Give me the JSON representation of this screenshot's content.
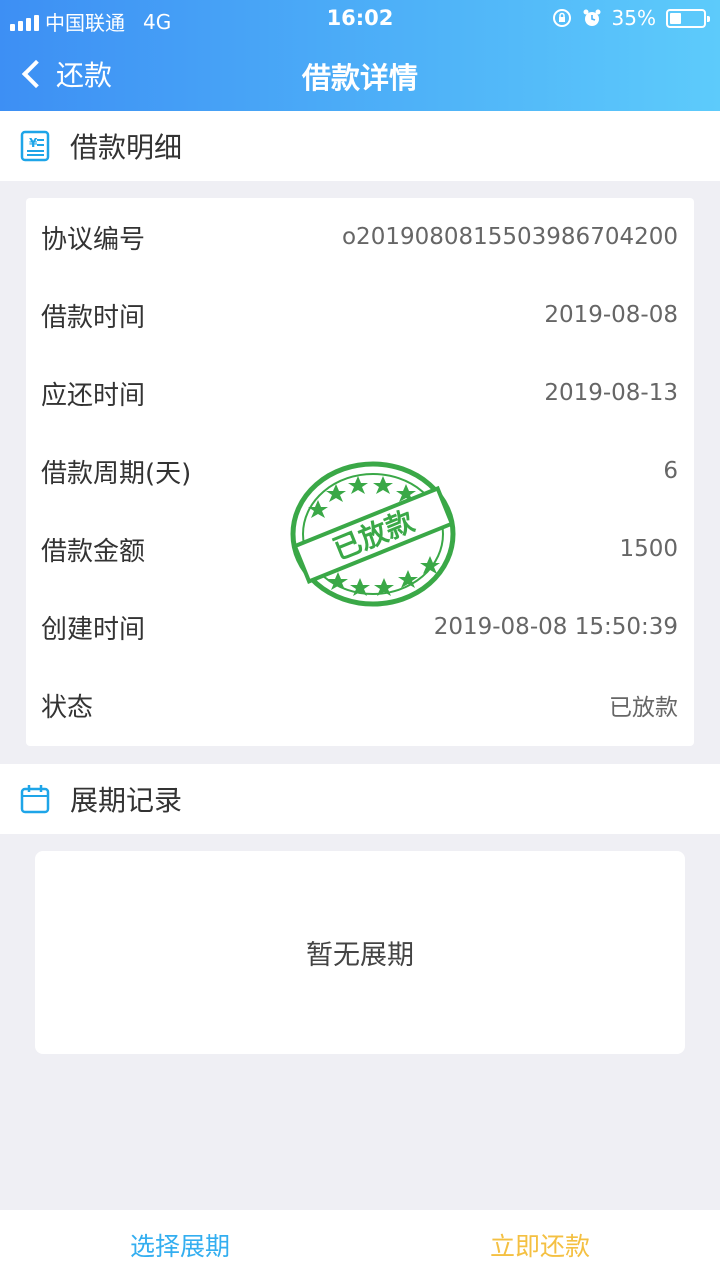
{
  "status_bar": {
    "carrier": "中国联通",
    "network": "4G",
    "time": "16:02",
    "battery": "35%",
    "battery_level": 0.35,
    "icons": [
      "signal-icon",
      "rotation-lock-icon",
      "alarm-icon",
      "battery-icon"
    ]
  },
  "nav": {
    "back_label": "还款",
    "title": "借款详情"
  },
  "detail_section": {
    "title": "借款明细",
    "icon": "receipt-icon",
    "rows": [
      {
        "label": "协议编号",
        "value": "o20190808155039867042​00"
      },
      {
        "label": "借款时间",
        "value": "2019-08-08"
      },
      {
        "label": "应还时间",
        "value": "2019-08-13"
      },
      {
        "label": "借款周期(天)",
        "value": "6"
      },
      {
        "label": "借款金额",
        "value": "1500"
      },
      {
        "label": "创建时间",
        "value": "2019-08-08 15:50:39"
      },
      {
        "label": "状态",
        "value": "已放款"
      }
    ],
    "stamp_text": "已放款"
  },
  "extension_section": {
    "title": "展期记录",
    "icon": "calendar-icon",
    "empty_text": "暂无展期"
  },
  "bottom_bar": {
    "extend_label": "选择展期",
    "repay_label": "立即还款"
  },
  "colors": {
    "header_start": "#3d8ff4",
    "header_end": "#5dcbfb",
    "extend_button": "#33aef0",
    "repay_button": "#f4c042",
    "stamp": "#3aa847"
  }
}
